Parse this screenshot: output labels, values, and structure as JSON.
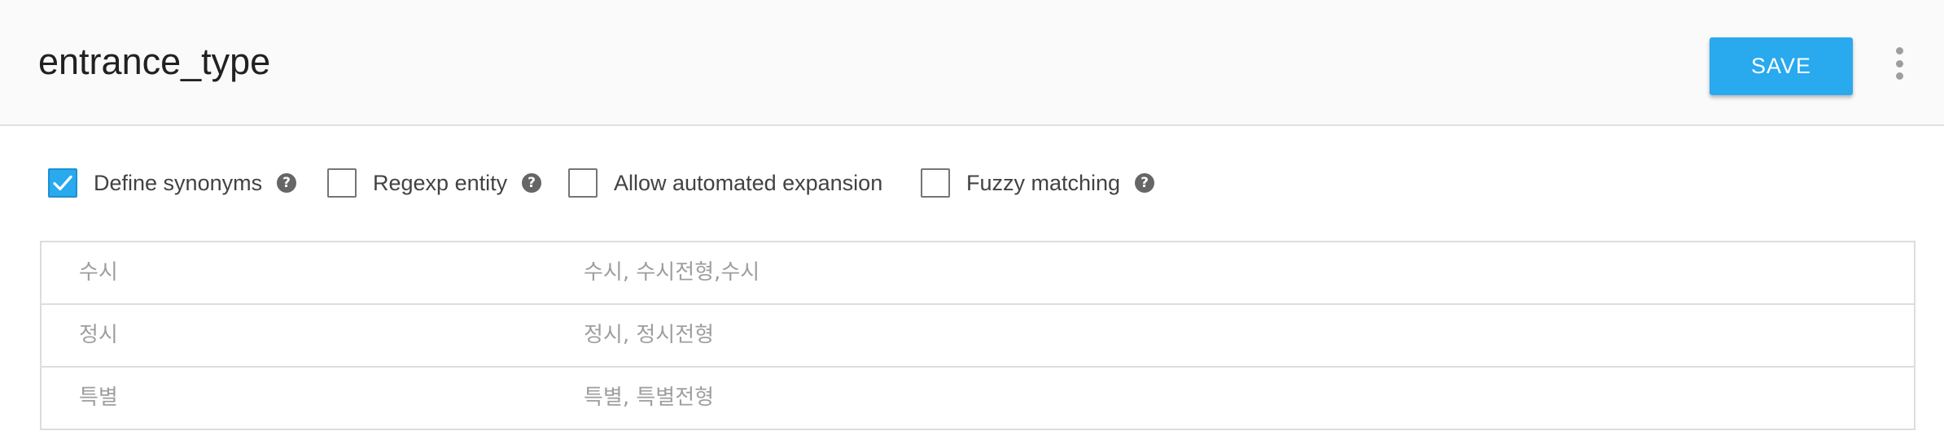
{
  "header": {
    "title": "entrance_type",
    "save_label": "SAVE",
    "more_icon": "more-vert-icon"
  },
  "options": [
    {
      "label": "Define synonyms",
      "checked": true,
      "help": true
    },
    {
      "label": "Regexp entity",
      "checked": false,
      "help": true
    },
    {
      "label": "Allow automated expansion",
      "checked": false,
      "help": false
    },
    {
      "label": "Fuzzy matching",
      "checked": false,
      "help": true
    }
  ],
  "help_glyph": "?",
  "check_glyph": "✓",
  "colors": {
    "accent": "#29a9ee",
    "header_bg": "#fafafa",
    "text_muted": "#9e9e9e",
    "border": "#dddddd"
  },
  "entries": [
    {
      "value": "수시",
      "synonyms": "수시, 수시전형,수시"
    },
    {
      "value": "정시",
      "synonyms": "정시, 정시전형"
    },
    {
      "value": "특별",
      "synonyms": "특별, 특별전형"
    }
  ]
}
